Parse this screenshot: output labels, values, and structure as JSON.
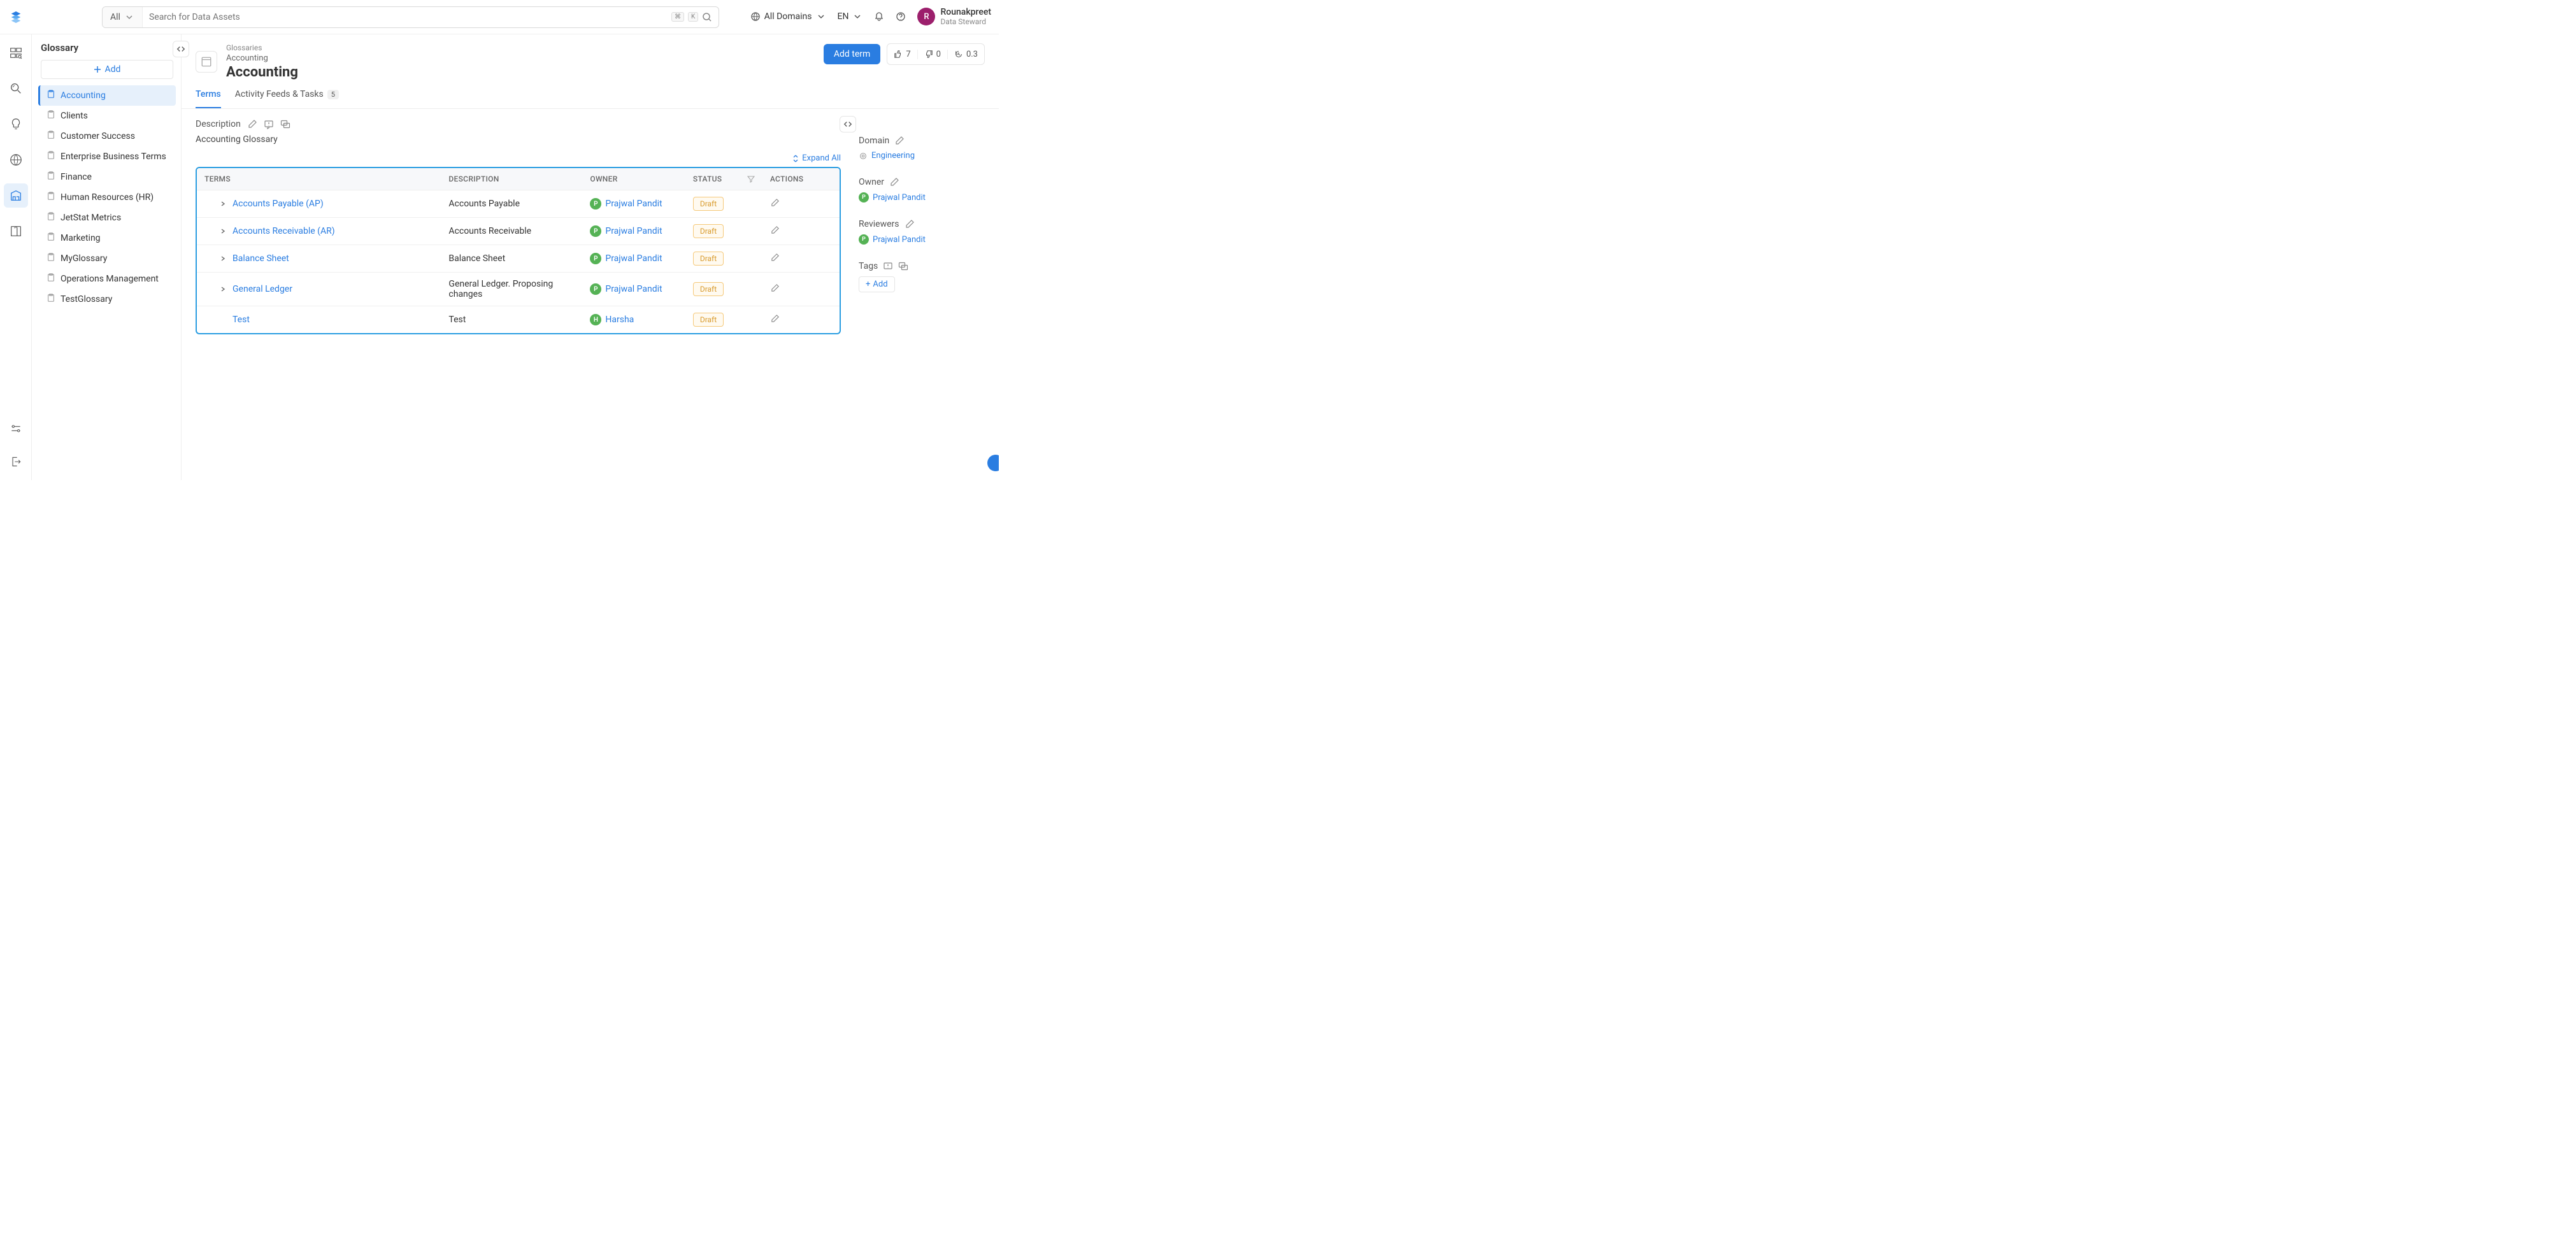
{
  "topbar": {
    "search_all_label": "All",
    "search_placeholder": "Search for Data Assets",
    "kbd1": "⌘",
    "kbd2": "K",
    "all_domains": "All Domains",
    "lang": "EN",
    "user_name": "Rounakpreet",
    "user_role": "Data Steward",
    "avatar_initial": "R"
  },
  "sidebar": {
    "title": "Glossary",
    "add_label": "Add",
    "items": [
      {
        "label": "Accounting",
        "active": true
      },
      {
        "label": "Clients"
      },
      {
        "label": "Customer Success"
      },
      {
        "label": "Enterprise Business Terms"
      },
      {
        "label": "Finance"
      },
      {
        "label": "Human Resources (HR)"
      },
      {
        "label": "JetStat Metrics"
      },
      {
        "label": "Marketing"
      },
      {
        "label": "MyGlossary"
      },
      {
        "label": "Operations Management"
      },
      {
        "label": "TestGlossary"
      }
    ]
  },
  "header": {
    "breadcrumb": "Glossaries",
    "crumb": "Accounting",
    "title": "Accounting",
    "add_term": "Add term",
    "likes": "7",
    "dislikes": "0",
    "time": "0.3"
  },
  "tabs": {
    "terms": "Terms",
    "activity": "Activity Feeds & Tasks",
    "activity_count": "5"
  },
  "description": {
    "label": "Description",
    "text": "Accounting Glossary",
    "expand": "Expand All"
  },
  "table": {
    "headers": {
      "terms": "TERMS",
      "description": "DESCRIPTION",
      "owner": "OWNER",
      "status": "STATUS",
      "actions": "ACTIONS"
    },
    "rows": [
      {
        "expandable": true,
        "term": "Accounts Payable (AP)",
        "desc": "Accounts Payable",
        "owner": "Prajwal Pandit",
        "owner_i": "P",
        "oc": "#55b255",
        "status": "Draft"
      },
      {
        "expandable": true,
        "term": "Accounts Receivable (AR)",
        "desc": "Accounts Receivable",
        "owner": "Prajwal Pandit",
        "owner_i": "P",
        "oc": "#55b255",
        "status": "Draft"
      },
      {
        "expandable": true,
        "term": "Balance Sheet",
        "desc": "Balance Sheet",
        "owner": "Prajwal Pandit",
        "owner_i": "P",
        "oc": "#55b255",
        "status": "Draft"
      },
      {
        "expandable": true,
        "term": "General Ledger",
        "desc": "General Ledger. Proposing changes",
        "owner": "Prajwal Pandit",
        "owner_i": "P",
        "oc": "#55b255",
        "status": "Draft"
      },
      {
        "expandable": false,
        "term": "Test",
        "desc": "Test",
        "owner": "Harsha",
        "owner_i": "H",
        "oc": "#55b255",
        "status": "Draft"
      }
    ]
  },
  "rp": {
    "domain_label": "Domain",
    "domain_value": "Engineering",
    "owner_label": "Owner",
    "owner_name": "Prajwal Pandit",
    "owner_i": "P",
    "owner_c": "#55b255",
    "reviewers_label": "Reviewers",
    "reviewer_name": "Prajwal Pandit",
    "reviewer_i": "P",
    "reviewer_c": "#55b255",
    "tags_label": "Tags",
    "tags_add": "Add"
  }
}
